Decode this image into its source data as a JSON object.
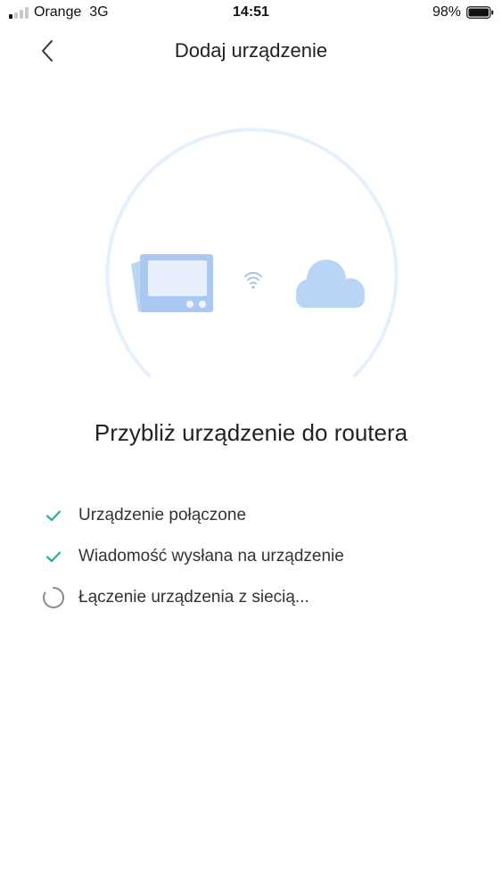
{
  "status_bar": {
    "carrier": "Orange",
    "network": "3G",
    "time": "14:51",
    "battery_percent": "98%",
    "battery_level": 0.98,
    "signal_bars_on": 1,
    "signal_bars_total": 4
  },
  "header": {
    "title": "Dodaj urządzenie",
    "back_icon": "chevron-left-icon"
  },
  "illustration": {
    "device_icon": "thermostat-device-icon",
    "link_icon": "wifi-icon",
    "cloud_icon": "cloud-icon"
  },
  "main": {
    "heading": "Przybliż urządzenie do routera"
  },
  "steps": [
    {
      "label": "Urządzenie połączone",
      "status": "done",
      "icon": "check-icon"
    },
    {
      "label": "Wiadomość wysłana na urządzenie",
      "status": "done",
      "icon": "check-icon"
    },
    {
      "label": "Łączenie urządzenia z siecią...",
      "status": "in-progress",
      "icon": "spinner-icon"
    }
  ],
  "colors": {
    "check": "#1fb39a",
    "spinner": "#8a8a8a",
    "device_blue": "#a9c9f2",
    "cloud_blue": "#b9d4f6",
    "ring": "#e6f1fb"
  }
}
